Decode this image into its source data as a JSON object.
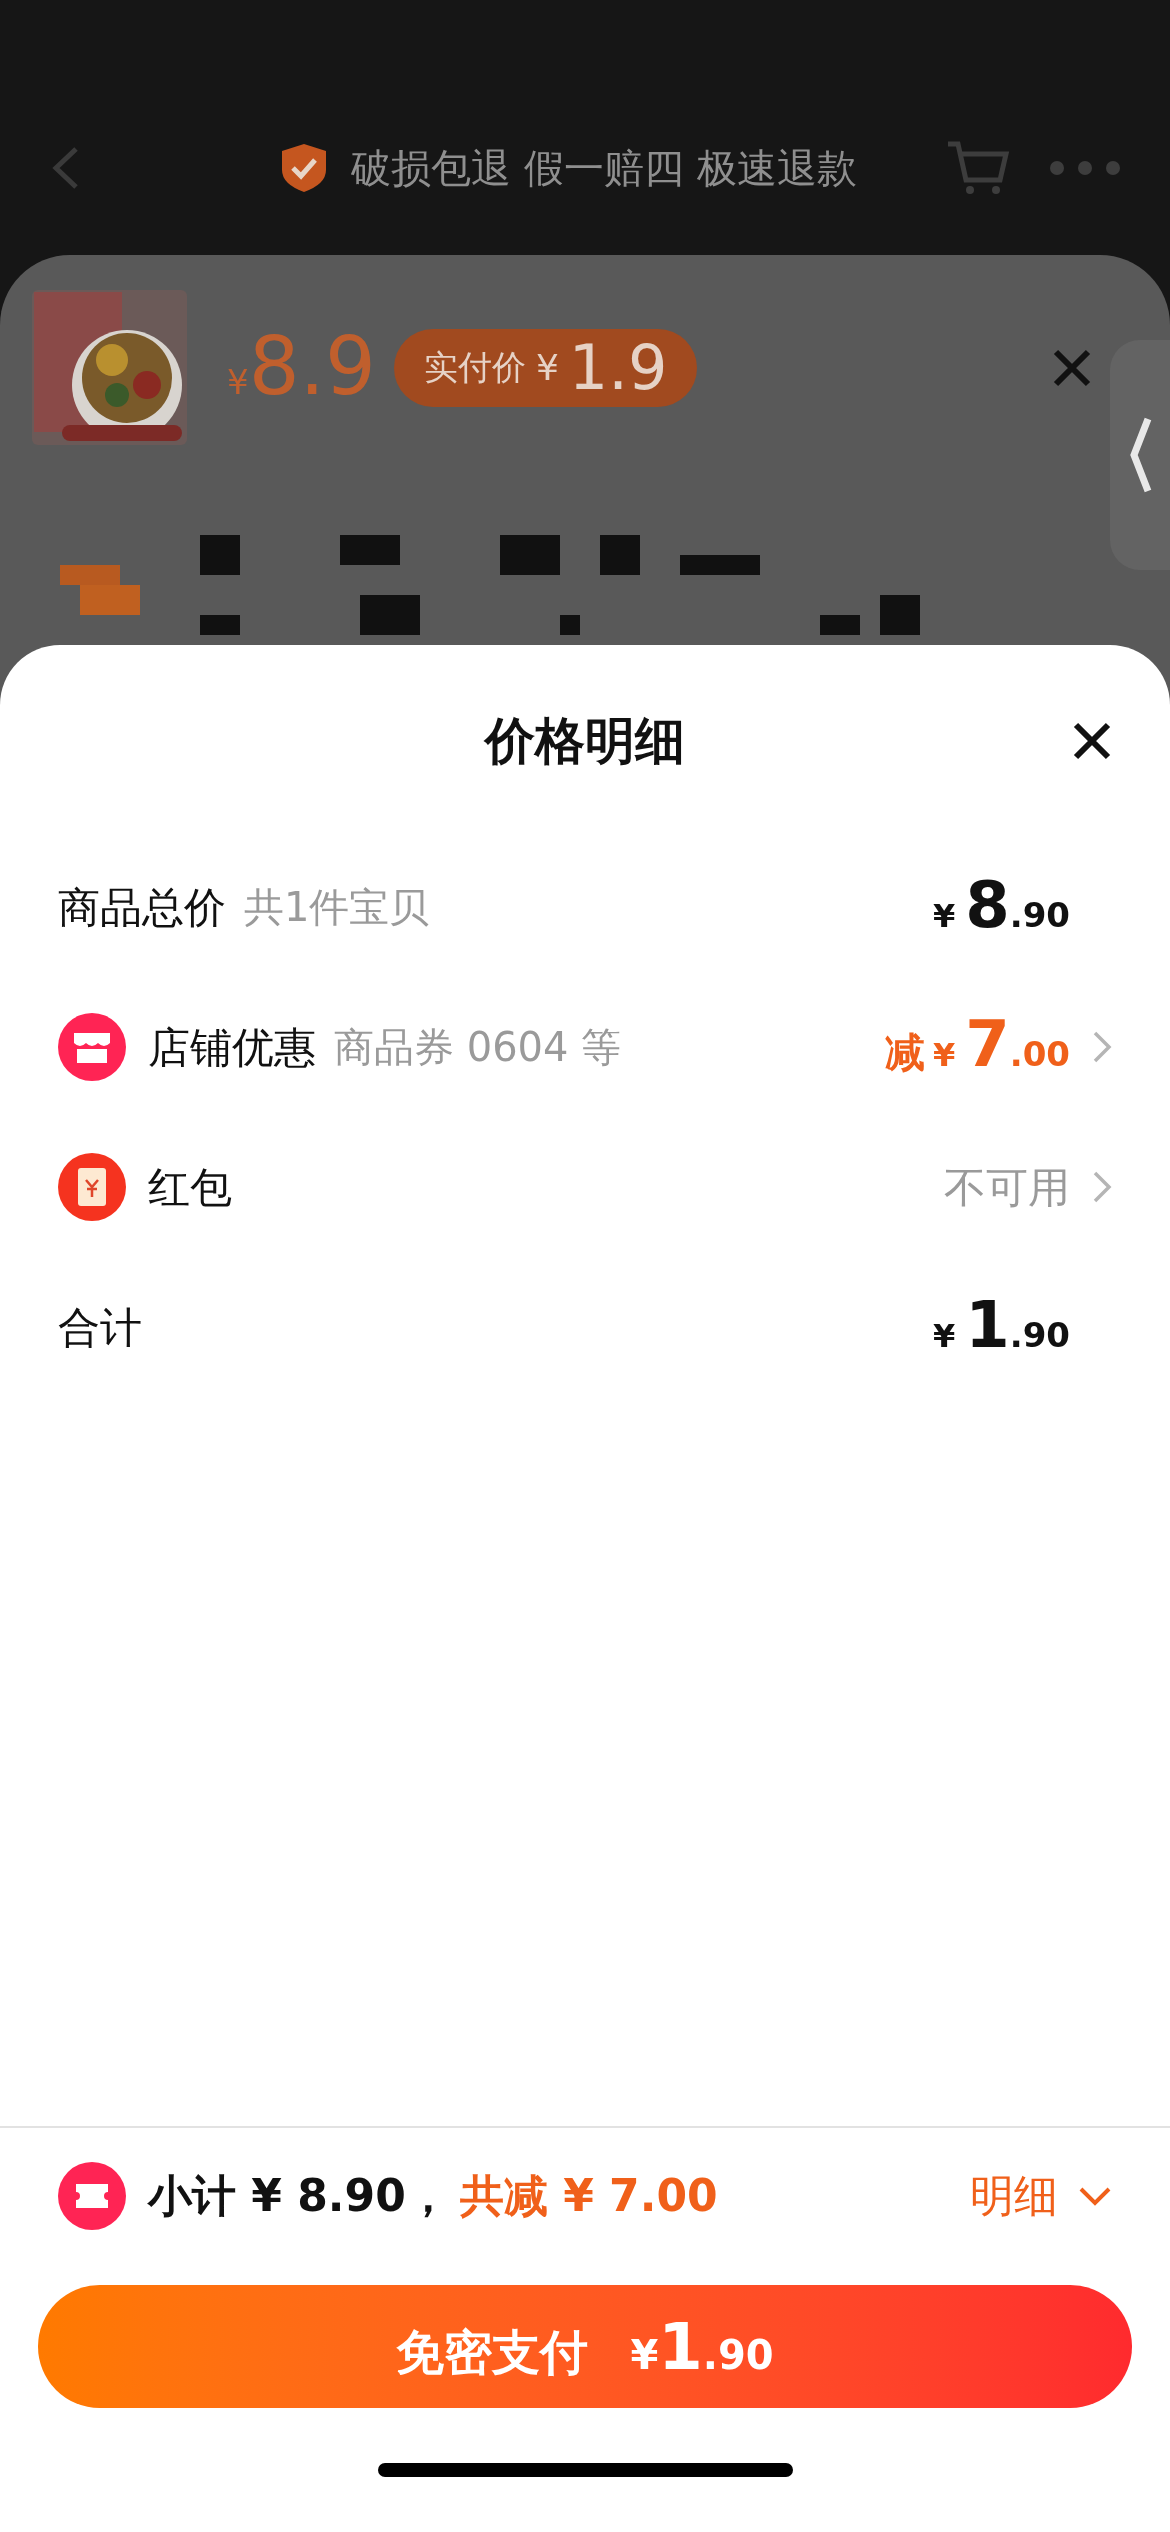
{
  "top_bar": {
    "guarantee": "破损包退 假一赔四 极速退款"
  },
  "product": {
    "price_symbol": "¥",
    "price": "8.9",
    "badge_label": "实付价",
    "badge_symbol": "¥",
    "badge_price": "1.9"
  },
  "sheet": {
    "title": "价格明细",
    "rows": [
      {
        "kind": "amount",
        "label": "商品总价",
        "note": "共1件宝贝",
        "symbol": "¥",
        "integer": "8",
        "decimals": ".90",
        "chevron": false
      },
      {
        "kind": "discount",
        "label": "店铺优惠",
        "note": "商品券 0604 等",
        "prefix": "减",
        "symbol": "¥",
        "integer": "7",
        "decimals": ".00",
        "chevron": true
      },
      {
        "kind": "text",
        "label": "红包",
        "value": "不可用",
        "chevron": true
      },
      {
        "kind": "amount",
        "label": "合计",
        "symbol": "¥",
        "integer": "1",
        "decimals": ".90",
        "chevron": false
      }
    ]
  },
  "summary": {
    "subtotal": "小计 ¥ 8.90，",
    "reduction": "共减 ¥ 7.00",
    "details_link": "明细"
  },
  "pay_button": {
    "label": "免密支付",
    "symbol": "¥",
    "integer": "1",
    "decimals": ".90"
  }
}
